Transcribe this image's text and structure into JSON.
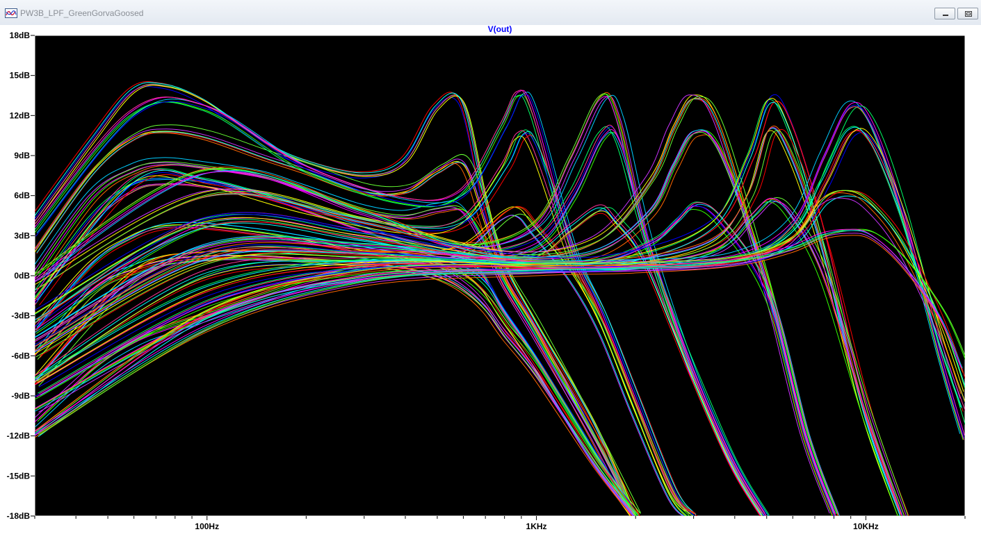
{
  "window": {
    "title": "PW3B_LPF_GreenGorvaGoosed",
    "minimize_icon": "minimize-icon",
    "restore_icon": "restore-icon",
    "app_icon": "ltspice-waveform-icon"
  },
  "colors": {
    "background": "#000000",
    "axis": "#ffffff",
    "title": "#0000ff",
    "palette": [
      "#00ff66",
      "#33ff00",
      "#0000ff",
      "#ff3399",
      "#ff0000",
      "#ffff00",
      "#00ffff",
      "#cc33ff",
      "#ff6600",
      "#66ff33"
    ]
  },
  "chart_data": {
    "type": "line",
    "title": "V(out)",
    "xscale": "log",
    "xlim": [
      30,
      20000
    ],
    "ylim": [
      -18,
      18
    ],
    "grid": false,
    "x_ticks": [
      {
        "value": 100,
        "label": "100Hz"
      },
      {
        "value": 1000,
        "label": "1KHz"
      },
      {
        "value": 10000,
        "label": "10KHz"
      }
    ],
    "y_ticks": [
      {
        "value": 18,
        "label": "18dB"
      },
      {
        "value": 15,
        "label": "15dB"
      },
      {
        "value": 12,
        "label": "12dB"
      },
      {
        "value": 9,
        "label": "9dB"
      },
      {
        "value": 6,
        "label": "6dB"
      },
      {
        "value": 3,
        "label": "3dB"
      },
      {
        "value": 0,
        "label": "0dB"
      },
      {
        "value": -3,
        "label": "-3dB"
      },
      {
        "value": -6,
        "label": "-6dB"
      },
      {
        "value": -9,
        "label": "-9dB"
      },
      {
        "value": -12,
        "label": "-12dB"
      },
      {
        "value": -15,
        "label": "-15dB"
      },
      {
        "value": -18,
        "label": "-18dB"
      }
    ],
    "series_color": [
      "#00ff66",
      "#0000ff",
      "#ff3399",
      "#ff0000",
      "#ffff00",
      "#00ffff",
      "#cc33ff",
      "#ff6600",
      "#66ff33",
      "#33ff00",
      "#00ccff",
      "#ff00ff"
    ],
    "families": [
      {
        "x": [
          30,
          45,
          60,
          75,
          100,
          150,
          200,
          300,
          400,
          500,
          600,
          700,
          800,
          1000,
          1500,
          2000
        ],
        "y": [
          4,
          10,
          13.8,
          14.2,
          13,
          10,
          8.5,
          7.5,
          8.5,
          12.5,
          13,
          6,
          1,
          -3.5,
          -11,
          -18
        ]
      },
      {
        "x": [
          30,
          45,
          60,
          75,
          100,
          150,
          200,
          300,
          400,
          500,
          600,
          700,
          800,
          1000,
          1500,
          2000
        ],
        "y": [
          2,
          8,
          10.5,
          11,
          10.5,
          9,
          8,
          6.5,
          6.5,
          8,
          8.5,
          4,
          0,
          -4,
          -12,
          -18
        ]
      },
      {
        "x": [
          30,
          45,
          60,
          75,
          100,
          150,
          200,
          300,
          400,
          500,
          600,
          700,
          800,
          1000,
          1500,
          2000
        ],
        "y": [
          0,
          6,
          8,
          8.5,
          8.2,
          7.5,
          6.5,
          5,
          4.5,
          5,
          5,
          2.5,
          -0.5,
          -4.5,
          -12,
          -18
        ]
      },
      {
        "x": [
          30,
          45,
          60,
          75,
          100,
          150,
          200,
          300,
          400,
          500,
          600,
          700,
          800,
          1000,
          1500,
          2000
        ],
        "y": [
          -2,
          4,
          6.5,
          7,
          6.8,
          6,
          5,
          3.5,
          2.5,
          2,
          1.5,
          0,
          -2.5,
          -6,
          -13,
          -18
        ]
      },
      {
        "x": [
          30,
          45,
          60,
          75,
          100,
          150,
          200,
          300,
          400,
          500,
          600,
          700,
          800,
          1000,
          1500,
          2000
        ],
        "y": [
          -4,
          1,
          3,
          3.8,
          3.8,
          3.3,
          2.8,
          2,
          1.5,
          1,
          0.5,
          -0.8,
          -3,
          -6.5,
          -13.5,
          -18
        ]
      },
      {
        "x": [
          30,
          45,
          60,
          75,
          100,
          150,
          200,
          300,
          400,
          500,
          600,
          700,
          800,
          1000,
          1500,
          2000
        ],
        "y": [
          -6,
          -1,
          0.5,
          1.2,
          1.5,
          1.5,
          1.3,
          1,
          0.6,
          0,
          -1,
          -2.5,
          -4.5,
          -7.5,
          -14,
          -18
        ]
      },
      {
        "x": [
          30,
          45,
          60,
          75,
          100,
          150,
          200,
          300,
          400,
          500,
          600,
          700,
          800,
          1000,
          1500,
          2000
        ],
        "y": [
          -11,
          -7,
          -5,
          -4,
          -3,
          -1.5,
          -0.5,
          0.5,
          0.8,
          0.5,
          -0.5,
          -2,
          -4,
          -7,
          -14,
          -18
        ]
      },
      {
        "x": [
          30,
          60,
          100,
          200,
          400,
          600,
          800,
          900,
          1000,
          1300,
          1600,
          2000,
          2600,
          3000
        ],
        "y": [
          3,
          12,
          12.5,
          8,
          5.5,
          6,
          11,
          13.5,
          12,
          2,
          -3,
          -9,
          -16,
          -18
        ]
      },
      {
        "x": [
          30,
          60,
          100,
          200,
          400,
          600,
          800,
          900,
          1000,
          1300,
          1600,
          2000,
          2600,
          3000
        ],
        "y": [
          -2,
          7,
          7,
          5,
          3.5,
          4,
          8,
          10.5,
          9.5,
          1.5,
          -3,
          -9,
          -16,
          -18
        ]
      },
      {
        "x": [
          30,
          60,
          100,
          200,
          400,
          600,
          800,
          900,
          1000,
          1300,
          1600,
          2000,
          2600,
          3000
        ],
        "y": [
          -8,
          0,
          1.5,
          1.5,
          1.5,
          2,
          4.5,
          4.8,
          3.5,
          0,
          -4,
          -10,
          -16.5,
          -18
        ]
      },
      {
        "x": [
          30,
          100,
          300,
          600,
          1000,
          1300,
          1600,
          1800,
          2200,
          3000,
          4000,
          5000
        ],
        "y": [
          0,
          8,
          5,
          2.5,
          4,
          9,
          13.5,
          12,
          3,
          -7,
          -14,
          -18
        ]
      },
      {
        "x": [
          30,
          100,
          300,
          600,
          1000,
          1300,
          1600,
          1800,
          2200,
          3000,
          4000,
          5000
        ],
        "y": [
          -4,
          4,
          3,
          1.5,
          2.5,
          6,
          10.5,
          10,
          2.5,
          -7,
          -14,
          -18
        ]
      },
      {
        "x": [
          30,
          100,
          300,
          600,
          1000,
          1300,
          1600,
          1800,
          2200,
          3000,
          4000,
          5000
        ],
        "y": [
          -8,
          0,
          1,
          1,
          1.5,
          3.5,
          5,
          4,
          1,
          -7,
          -14,
          -18
        ]
      },
      {
        "x": [
          30,
          100,
          300,
          800,
          1500,
          2200,
          2600,
          3000,
          3600,
          5000,
          6500,
          8000
        ],
        "y": [
          -1,
          6,
          4,
          1.5,
          2.5,
          7,
          11,
          13.3,
          11,
          -1,
          -12,
          -18
        ]
      },
      {
        "x": [
          30,
          100,
          300,
          800,
          1500,
          2200,
          2600,
          3000,
          3600,
          5000,
          6500,
          8000
        ],
        "y": [
          -5,
          2,
          2,
          1,
          1.5,
          4.5,
          8,
          10.5,
          9,
          -1,
          -12,
          -18
        ]
      },
      {
        "x": [
          30,
          100,
          300,
          800,
          1500,
          2200,
          2600,
          3000,
          3600,
          5000,
          6500,
          8000
        ],
        "y": [
          -9,
          -2,
          0.5,
          0.8,
          1,
          2.5,
          4,
          5.3,
          4,
          -1.5,
          -12,
          -18
        ]
      },
      {
        "x": [
          30,
          100,
          300,
          1000,
          2000,
          3500,
          4500,
          5200,
          6000,
          7500,
          10000,
          13000
        ],
        "y": [
          -3,
          4,
          3,
          1,
          1.5,
          4,
          9,
          13.2,
          11,
          3,
          -10,
          -18
        ]
      },
      {
        "x": [
          30,
          100,
          300,
          1000,
          2000,
          3500,
          4500,
          5200,
          6000,
          7500,
          10000,
          13000
        ],
        "y": [
          -6,
          1,
          1.5,
          0.8,
          1,
          2.5,
          6,
          10.8,
          9,
          2,
          -10,
          -18
        ]
      },
      {
        "x": [
          30,
          100,
          300,
          1000,
          2000,
          3500,
          4500,
          5200,
          6000,
          7500,
          10000,
          13000
        ],
        "y": [
          -10,
          -3,
          0,
          0.5,
          0.8,
          2,
          4.5,
          5.8,
          4.5,
          0,
          -10,
          -18
        ]
      },
      {
        "x": [
          30,
          100,
          300,
          1000,
          2000,
          4000,
          6000,
          7500,
          9000,
          10500,
          13000,
          17000,
          20000
        ],
        "y": [
          -5,
          2,
          2,
          1,
          1,
          1.5,
          4,
          9,
          12.8,
          11.5,
          5,
          -6,
          -12
        ]
      },
      {
        "x": [
          30,
          100,
          300,
          1000,
          2000,
          4000,
          6000,
          7500,
          9000,
          10500,
          13000,
          17000,
          20000
        ],
        "y": [
          -8,
          -1,
          1,
          0.8,
          0.8,
          1.2,
          3,
          7,
          10.8,
          10,
          4.5,
          -5,
          -10
        ]
      },
      {
        "x": [
          30,
          100,
          300,
          1000,
          2000,
          4000,
          6000,
          7500,
          9000,
          10500,
          13000,
          17000,
          20000
        ],
        "y": [
          -12,
          -3,
          0,
          0.5,
          0.6,
          1,
          2.5,
          5.5,
          6,
          5,
          2,
          -4,
          -9
        ]
      },
      {
        "x": [
          30,
          100,
          300,
          1000,
          2000,
          4000,
          6000,
          7500,
          9000,
          10500,
          13000,
          17000,
          20000
        ],
        "y": [
          -12,
          -4,
          -0.5,
          0.3,
          0.5,
          1,
          2,
          3,
          3.3,
          3,
          1,
          -3,
          -7
        ]
      }
    ]
  }
}
